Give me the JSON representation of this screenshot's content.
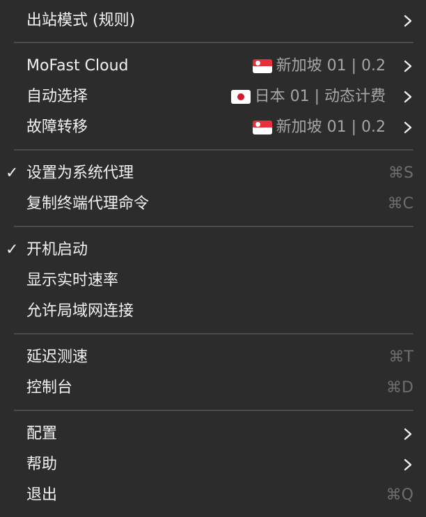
{
  "menu": {
    "outbound_mode": {
      "label": "出站模式 (规则)"
    },
    "proxy_groups": [
      {
        "label": "MoFast Cloud",
        "flag": "sg",
        "value": "新加坡 01 | 0.2"
      },
      {
        "label": "自动选择",
        "flag": "jp",
        "value": "日本 01 | 动态计费"
      },
      {
        "label": "故障转移",
        "flag": "sg",
        "value": "新加坡 01 | 0.2"
      }
    ],
    "system_proxy": {
      "label": "设置为系统代理",
      "checked": true,
      "shortcut": "⌘S"
    },
    "copy_command": {
      "label": "复制终端代理命令",
      "shortcut": "⌘C"
    },
    "launch_at_login": {
      "label": "开机启动",
      "checked": true
    },
    "show_speed": {
      "label": "显示实时速率"
    },
    "allow_lan": {
      "label": "允许局域网连接"
    },
    "latency_test": {
      "label": "延迟测速",
      "shortcut": "⌘T"
    },
    "console": {
      "label": "控制台",
      "shortcut": "⌘D"
    },
    "config": {
      "label": "配置"
    },
    "help": {
      "label": "帮助"
    },
    "quit": {
      "label": "退出",
      "shortcut": "⌘Q"
    },
    "check_glyph": "✓"
  },
  "colors": {
    "background": "#2c2c2c",
    "text": "#f2f2f2",
    "secondary_text": "#a6a6a6",
    "shortcut_text": "#6e6e6e",
    "separator": "#4a4a4a"
  },
  "icons": {
    "submenu": "chevron-right-icon",
    "checked": "checkmark-icon",
    "flag_sg": "singapore-flag-icon",
    "flag_jp": "japan-flag-icon"
  }
}
